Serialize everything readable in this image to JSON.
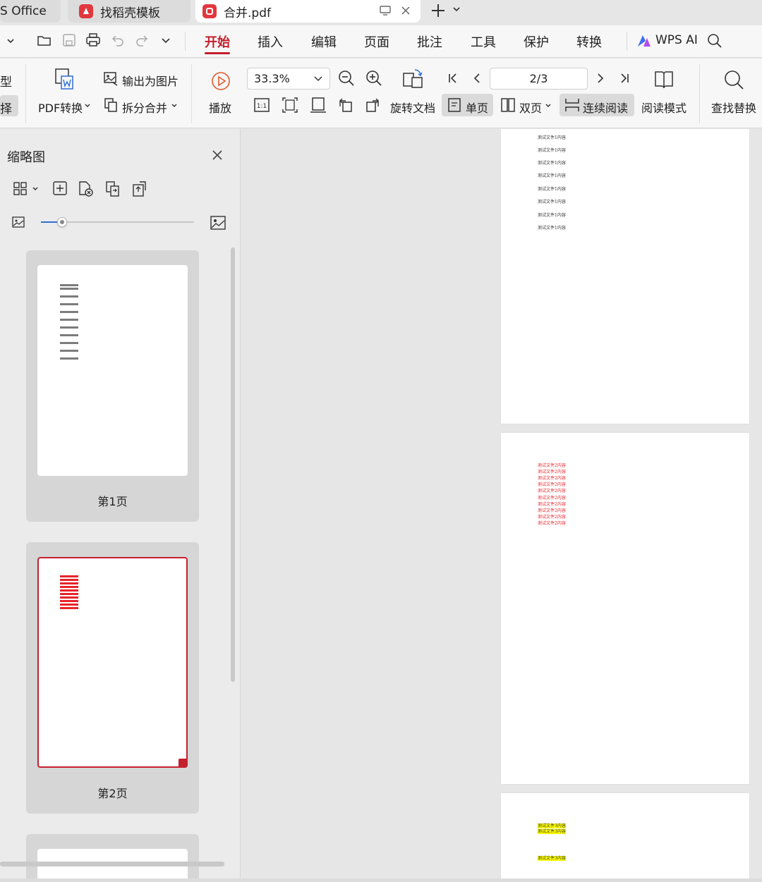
{
  "tabs": [
    {
      "label": "S Office"
    },
    {
      "label": "找稻壳模板"
    },
    {
      "label": "合并.pdf"
    }
  ],
  "menu": {
    "items": [
      "开始",
      "插入",
      "编辑",
      "页面",
      "批注",
      "工具",
      "保护",
      "转换"
    ],
    "wps_ai": "WPS AI"
  },
  "ribbon": {
    "left_cut_1": "型",
    "left_cut_2": "择",
    "export_image": "输出为图片",
    "pdf_convert": "PDF转换",
    "split_merge": "拆分合并",
    "play": "播放",
    "zoom": "33.3%",
    "rotate_doc": "旋转文档",
    "page_indicator": "2/3",
    "single_page": "单页",
    "double_page": "双页",
    "continuous": "连续阅读",
    "read_mode": "阅读模式",
    "find_replace": "查找替换"
  },
  "sidebar": {
    "title": "缩略图",
    "thumbs": [
      {
        "label": "第1页"
      },
      {
        "label": "第2页"
      }
    ]
  },
  "document": {
    "page1_lines": [
      "测试文件1内容",
      "测试文件1内容",
      "测试文件1内容",
      "测试文件1内容",
      "测试文件1内容",
      "测试文件1内容",
      "测试文件1内容",
      "测试文件1内容"
    ],
    "page2_lines": [
      "测试文件2内容",
      "测试文件2内容",
      "测试文件2内容",
      "测试文件2内容",
      "测试文件2内容",
      "测试文件2内容",
      "测试文件2内容",
      "测试文件2内容",
      "测试文件2内容",
      "测试文件2内容"
    ],
    "page3_lines": [
      "测试文件3内容",
      "测试文件3内容",
      "测试文件3内容"
    ]
  },
  "colors": {
    "accent": "#c4202e",
    "page2_text": "#e8232a",
    "page3_highlight": "#ffff00",
    "slider": "#2f6fd6"
  }
}
